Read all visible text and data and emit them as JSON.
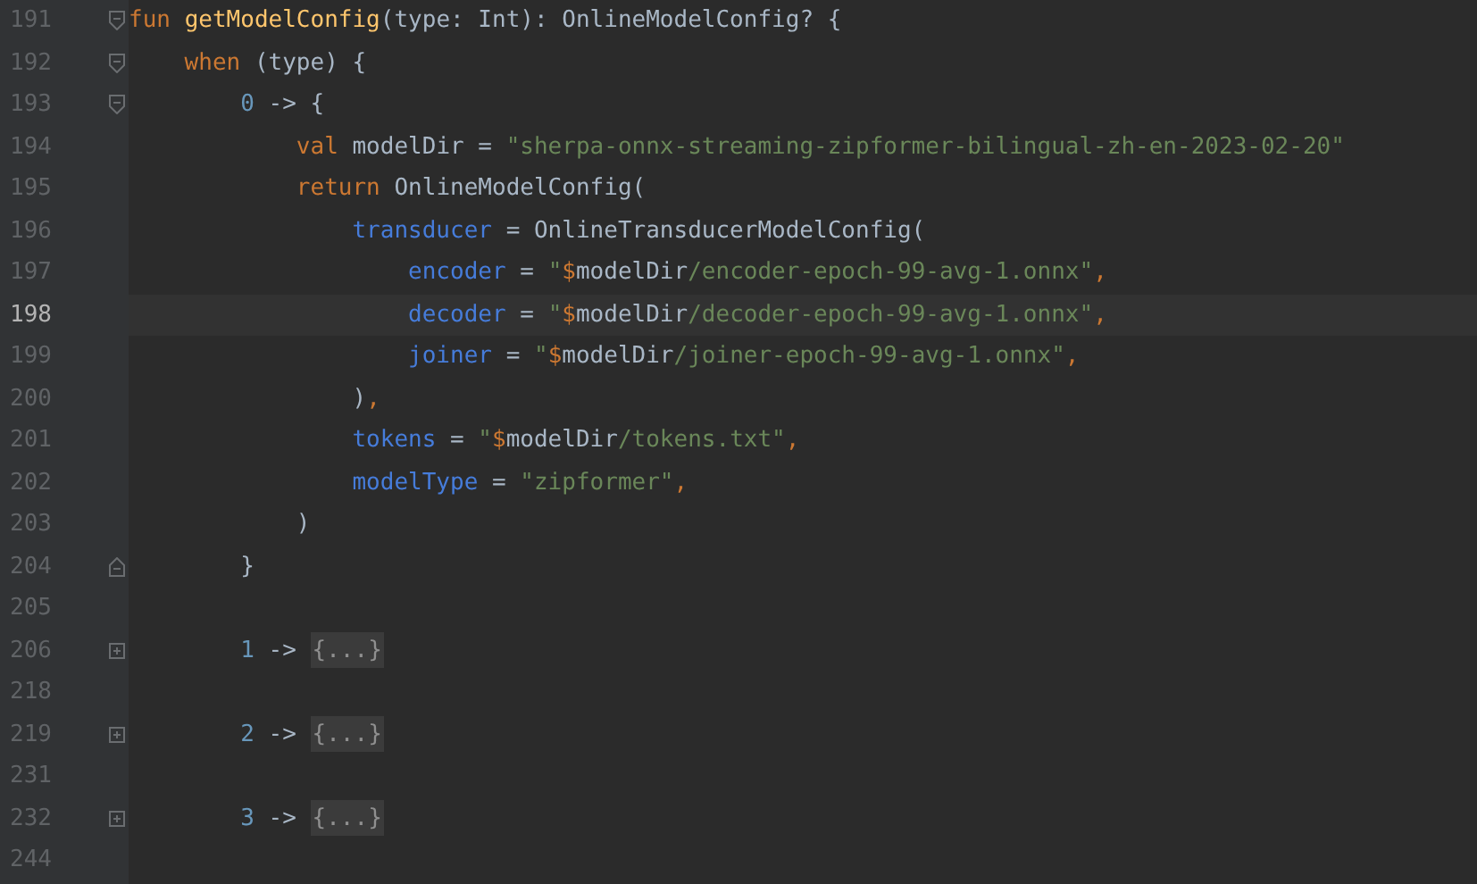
{
  "editor": {
    "lines": [
      {
        "number": "191",
        "kind": "opener",
        "selected": false,
        "tokens": [
          {
            "kind": "keyword",
            "text": "fun "
          },
          {
            "kind": "function",
            "text": "getModelConfig"
          },
          {
            "kind": "plain",
            "text": "(type: Int): OnlineModelConfig? {"
          }
        ]
      },
      {
        "number": "192",
        "kind": "opener",
        "selected": false,
        "tokens": [
          {
            "kind": "keyword",
            "text": "    when "
          },
          {
            "kind": "plain",
            "text": "(type) {"
          }
        ]
      },
      {
        "number": "193",
        "kind": "opener",
        "selected": false,
        "tokens": [
          {
            "kind": "number",
            "text": "        0"
          },
          {
            "kind": "plain",
            "text": " -> {"
          }
        ]
      },
      {
        "number": "194",
        "kind": "plain",
        "selected": false,
        "tokens": [
          {
            "kind": "keyword",
            "text": "            val "
          },
          {
            "kind": "plain",
            "text": "modelDir = "
          },
          {
            "kind": "string",
            "text": "\"sherpa-onnx-streaming-zipformer-bilingual-zh-en-2023-02-20\""
          }
        ]
      },
      {
        "number": "195",
        "kind": "plain",
        "selected": false,
        "tokens": [
          {
            "kind": "keyword",
            "text": "            return "
          },
          {
            "kind": "plain",
            "text": "OnlineModelConfig("
          }
        ]
      },
      {
        "number": "196",
        "kind": "plain",
        "selected": false,
        "tokens": [
          {
            "kind": "argument",
            "text": "                transducer"
          },
          {
            "kind": "plain",
            "text": " = OnlineTransducerModelConfig("
          }
        ]
      },
      {
        "number": "197",
        "kind": "plain",
        "selected": false,
        "tokens": [
          {
            "kind": "argument",
            "text": "                    encoder"
          },
          {
            "kind": "plain",
            "text": " = "
          },
          {
            "kind": "string",
            "text": "\""
          },
          {
            "kind": "keyword",
            "text": "$"
          },
          {
            "kind": "plain",
            "text": "modelDir"
          },
          {
            "kind": "string",
            "text": "/encoder-epoch-99-avg-1.onnx\""
          },
          {
            "kind": "keyword",
            "text": ","
          }
        ]
      },
      {
        "number": "198",
        "kind": "plain",
        "selected": true,
        "tokens": [
          {
            "kind": "argument",
            "text": "                    decoder"
          },
          {
            "kind": "plain",
            "text": " = "
          },
          {
            "kind": "string",
            "text": "\""
          },
          {
            "kind": "keyword",
            "text": "$"
          },
          {
            "kind": "plain",
            "text": "modelDir"
          },
          {
            "kind": "string",
            "text": "/decoder-epoch-99-avg-1.onnx\""
          },
          {
            "kind": "keyword",
            "text": ","
          }
        ]
      },
      {
        "number": "199",
        "kind": "plain",
        "selected": false,
        "tokens": [
          {
            "kind": "argument",
            "text": "                    joiner"
          },
          {
            "kind": "plain",
            "text": " = "
          },
          {
            "kind": "string",
            "text": "\""
          },
          {
            "kind": "keyword",
            "text": "$"
          },
          {
            "kind": "plain",
            "text": "modelDir"
          },
          {
            "kind": "string",
            "text": "/joiner-epoch-99-avg-1.onnx\""
          },
          {
            "kind": "keyword",
            "text": ","
          }
        ]
      },
      {
        "number": "200",
        "kind": "plain",
        "selected": false,
        "tokens": [
          {
            "kind": "plain",
            "text": "                )"
          },
          {
            "kind": "keyword",
            "text": ","
          }
        ]
      },
      {
        "number": "201",
        "kind": "plain",
        "selected": false,
        "tokens": [
          {
            "kind": "argument",
            "text": "                tokens"
          },
          {
            "kind": "plain",
            "text": " = "
          },
          {
            "kind": "string",
            "text": "\""
          },
          {
            "kind": "keyword",
            "text": "$"
          },
          {
            "kind": "plain",
            "text": "modelDir"
          },
          {
            "kind": "string",
            "text": "/tokens.txt\""
          },
          {
            "kind": "keyword",
            "text": ","
          }
        ]
      },
      {
        "number": "202",
        "kind": "plain",
        "selected": false,
        "tokens": [
          {
            "kind": "argument",
            "text": "                modelType"
          },
          {
            "kind": "plain",
            "text": " = "
          },
          {
            "kind": "string",
            "text": "\"zipformer\""
          },
          {
            "kind": "keyword",
            "text": ","
          }
        ]
      },
      {
        "number": "203",
        "kind": "plain",
        "selected": false,
        "tokens": [
          {
            "kind": "plain",
            "text": "            )"
          }
        ]
      },
      {
        "number": "204",
        "kind": "closer",
        "selected": false,
        "tokens": [
          {
            "kind": "plain",
            "text": "        }"
          }
        ]
      },
      {
        "number": "205",
        "kind": "plain",
        "selected": false
      },
      {
        "number": "206",
        "kind": "folded",
        "selected": false,
        "tokens": [
          {
            "kind": "number",
            "text": "        1"
          },
          {
            "kind": "plain",
            "text": " -> "
          }
        ],
        "folded": "{...}"
      },
      {
        "number": "218",
        "kind": "plain",
        "selected": false
      },
      {
        "number": "219",
        "kind": "folded",
        "selected": false,
        "tokens": [
          {
            "kind": "number",
            "text": "        2"
          },
          {
            "kind": "plain",
            "text": " -> "
          }
        ],
        "folded": "{...}"
      },
      {
        "number": "231",
        "kind": "plain",
        "selected": false
      },
      {
        "number": "232",
        "kind": "folded",
        "selected": false,
        "tokens": [
          {
            "kind": "number",
            "text": "        3"
          },
          {
            "kind": "plain",
            "text": " -> "
          }
        ],
        "folded": "{...}"
      },
      {
        "number": "244",
        "kind": "plain",
        "selected": false
      }
    ]
  }
}
